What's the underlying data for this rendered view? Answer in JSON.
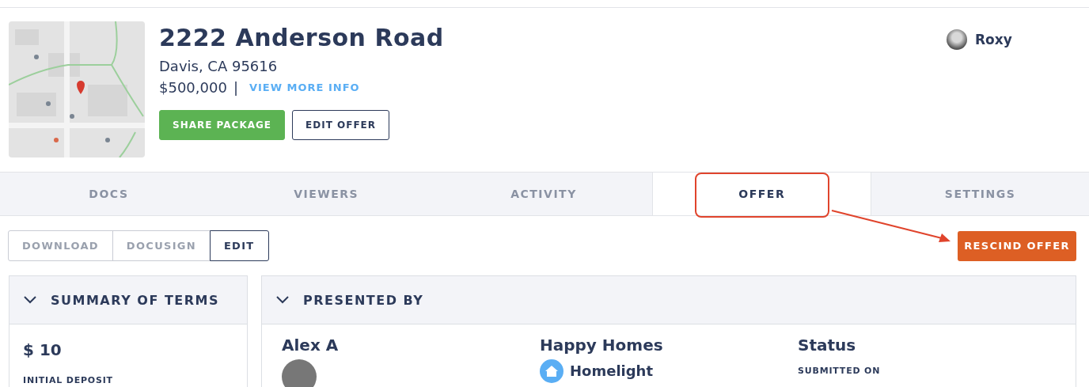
{
  "property": {
    "title": "2222 Anderson Road",
    "city": "Davis, CA 95616",
    "price": "$500,000",
    "separator": "|",
    "more_link": "VIEW MORE INFO"
  },
  "actions": [
    {
      "label": "SHARE PACKAGE",
      "kind": "primary"
    },
    {
      "label": "EDIT OFFER",
      "kind": "outline"
    }
  ],
  "user": {
    "name": "Roxy"
  },
  "tabs": [
    {
      "label": "DOCS",
      "selected": false
    },
    {
      "label": "VIEWERS",
      "selected": false
    },
    {
      "label": "ACTIVITY",
      "selected": false
    },
    {
      "label": "OFFER",
      "selected": true
    },
    {
      "label": "SETTINGS",
      "selected": false
    }
  ],
  "doc_buttons": [
    {
      "label": "DOWNLOAD",
      "selected": false
    },
    {
      "label": "DOCUSIGN",
      "selected": false
    },
    {
      "label": "EDIT",
      "selected": true
    }
  ],
  "rescind_button": "RESCIND OFFER",
  "summary": {
    "title": "SUMMARY OF TERMS",
    "expanded": true,
    "amount": "$ 10",
    "amount_label": "INITIAL DEPOSIT"
  },
  "presented_by": {
    "title": "PRESENTED BY",
    "expanded": true,
    "agent": "Alex A",
    "brokerage": "Happy Homes",
    "brokerage_logo": "Homelight",
    "status_title": "Status",
    "status_label": "SUBMITTED ON"
  }
}
